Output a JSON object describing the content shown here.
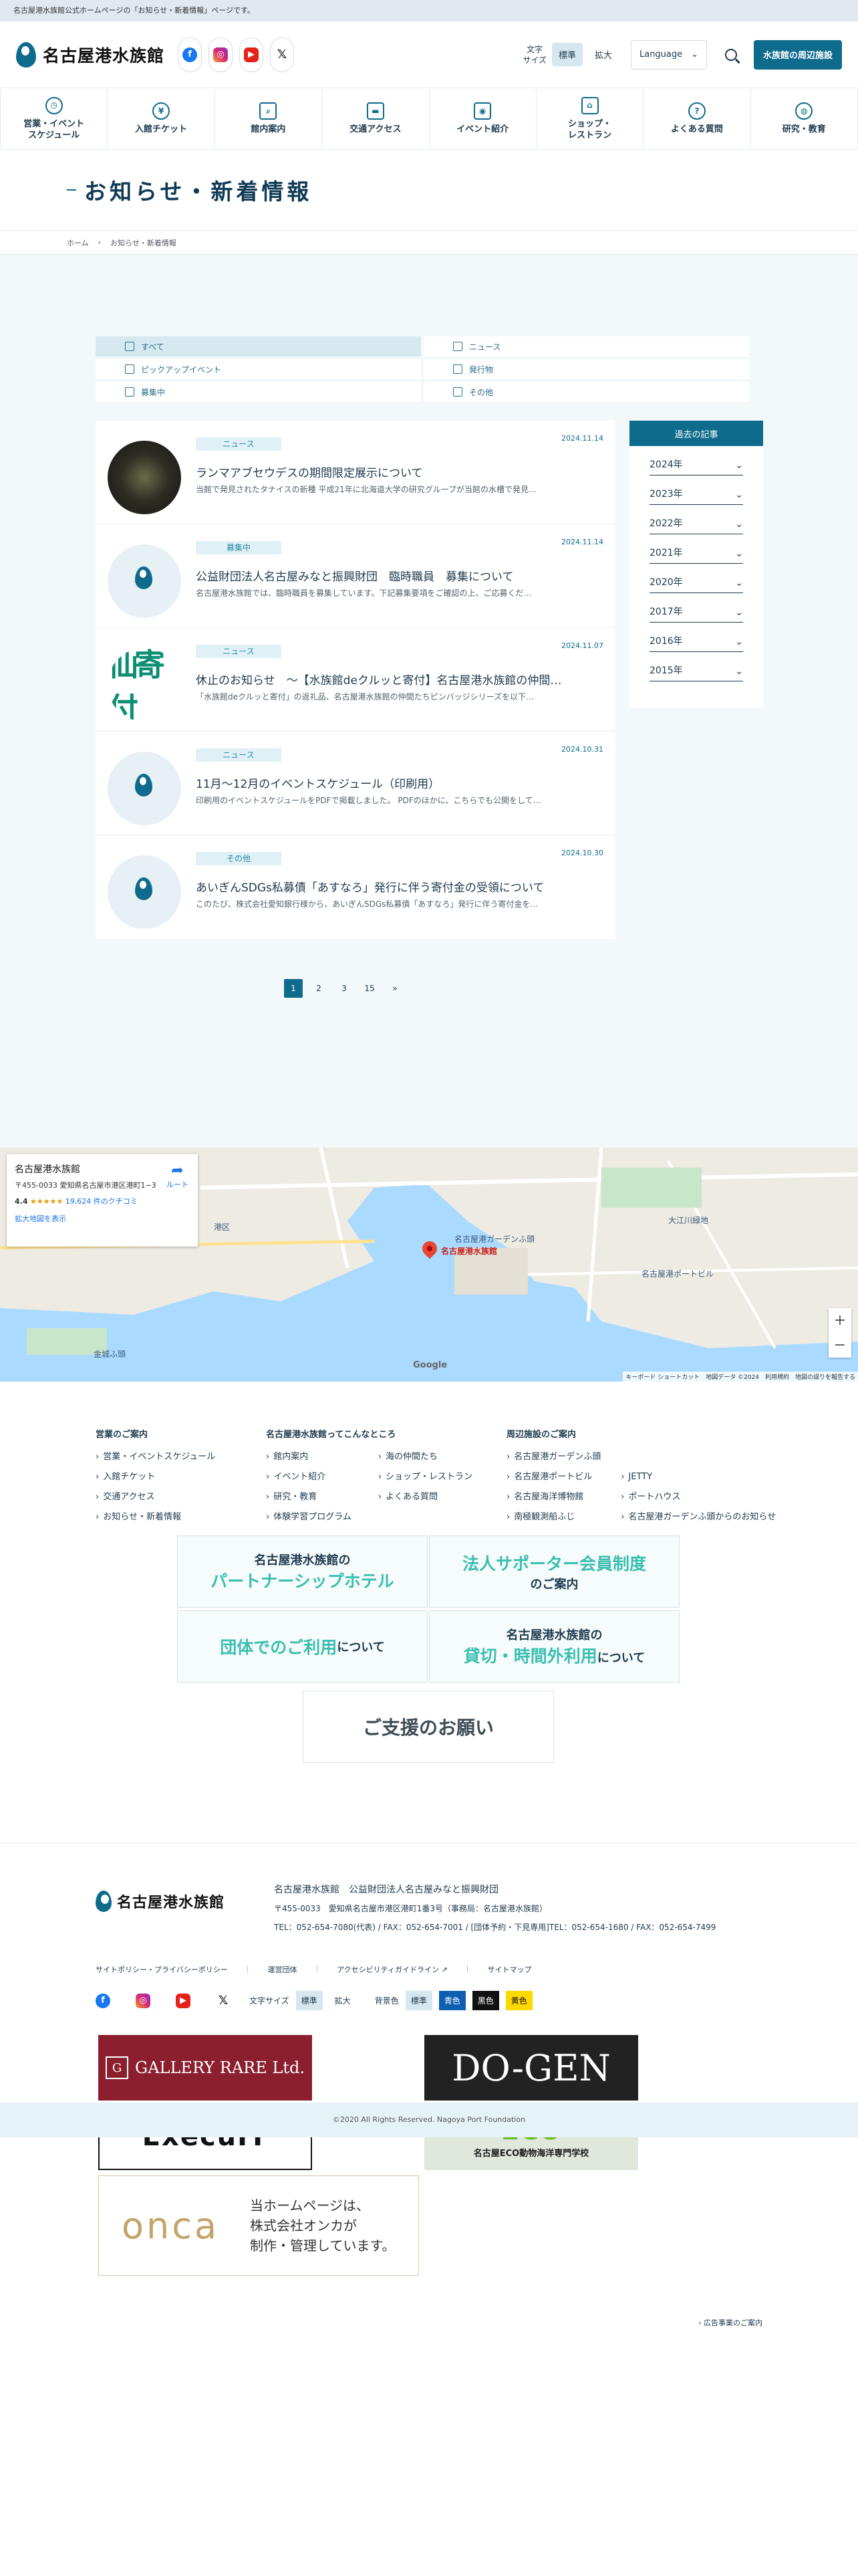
{
  "topnote": "名古屋港水族館公式ホームページの「お知らせ・新着情報」ページです。",
  "header": {
    "logo_text": "名古屋港水族館",
    "fontsize_label": "文字\nサイズ",
    "fontsize_std": "標準",
    "fontsize_large": "拡大",
    "language": "Language",
    "nearby": "水族館の周辺施設"
  },
  "gnav": [
    {
      "label": "営業・イベント\nスケジュール",
      "icon": "clock-icon"
    },
    {
      "label": "入館チケット",
      "icon": "yen-icon"
    },
    {
      "label": "館内案内",
      "icon": "map-search-icon"
    },
    {
      "label": "交通アクセス",
      "icon": "bus-icon"
    },
    {
      "label": "イベント紹介",
      "icon": "camera-icon"
    },
    {
      "label": "ショップ・\nレストラン",
      "icon": "shop-icon"
    },
    {
      "label": "よくある質問",
      "icon": "question-icon"
    },
    {
      "label": "研究・教育",
      "icon": "globe-icon"
    }
  ],
  "page": {
    "title": "お知らせ・新着情報",
    "breadcrumb_home": "ホーム",
    "breadcrumb_current": "お知らせ・新着情報"
  },
  "filters": [
    {
      "label": "すべて",
      "active": true
    },
    {
      "label": "ニュース"
    },
    {
      "label": "ピックアップイベント"
    },
    {
      "label": "発行物"
    },
    {
      "label": "募集中"
    },
    {
      "label": "その他"
    }
  ],
  "news": [
    {
      "tag": "ニュース",
      "date": "2024.11.14",
      "title": "ランマアブセウデスの期間限定展示について",
      "excerpt": "当館で発見されたタナイスの新種 平成21年に北海道大学の研究グループが当館の水槽で発見…",
      "thumb": "dark"
    },
    {
      "tag": "募集中",
      "date": "2024.11.14",
      "title": "公益財団法人名古屋みなと振興財団　臨時職員　募集について",
      "excerpt": "名古屋港水族館では、臨時職員を募集しています。下記募集要項をご確認の上、ご応募くだ…",
      "thumb": "logo"
    },
    {
      "tag": "ニュース",
      "date": "2024.11.07",
      "title": "休止のお知らせ　～【水族館deクルッと寄付】名古屋港水族館の仲間…",
      "excerpt": "「水族館deクルッと寄付」の返礼品、名古屋港水族館の仲間たちピンバッジシリーズを以下…",
      "thumb": "green"
    },
    {
      "tag": "ニュース",
      "date": "2024.10.31",
      "title": "11月～12月のイベントスケジュール（印刷用）",
      "excerpt": "印刷用のイベントスケジュールをPDFで掲載しました。 PDFのほかに、こちらでも公開をして…",
      "thumb": "logo"
    },
    {
      "tag": "その他",
      "date": "2024.10.30",
      "title": "あいぎんSDGs私募債「あすなろ」発行に伴う寄付金の受領について",
      "excerpt": "このたび、株式会社愛知銀行様から、あいぎんSDGs私募債「あすなろ」発行に伴う寄付金を…",
      "thumb": "logo"
    }
  ],
  "news_thumb_green_text": "仙寄付",
  "archive": {
    "heading": "過去の記事",
    "years": [
      "2024年",
      "2023年",
      "2022年",
      "2021年",
      "2020年",
      "2017年",
      "2016年",
      "2015年"
    ]
  },
  "pager": [
    "1",
    "2",
    "3",
    "15",
    "»"
  ],
  "map": {
    "place_name": "名古屋港水族館",
    "address": "〒455-0033 愛知県名古屋市港区港町1−3",
    "rating": "4.4",
    "stars": "★★★★★",
    "reviews": "19,624 件のクチコミ",
    "larger_map": "拡大地図を表示",
    "route": "ルート",
    "pin_label": "名古屋港水族館",
    "google": "Google",
    "footer": "キーボード ショートカット　地図データ ©2024　利用規約　地図の誤りを報告する",
    "labels": [
      "港区",
      "名古屋港ポートビル",
      "大江川緑地",
      "名古屋港ガーデンふ頭",
      "金城ふ頭"
    ]
  },
  "footer": {
    "col1_title": "営業のご案内",
    "col1": [
      "営業・イベントスケジュール",
      "入館チケット",
      "交通アクセス",
      "お知らせ・新着情報"
    ],
    "col2_title": "名古屋港水族館ってこんなところ",
    "col2a": [
      "館内案内",
      "イベント紹介",
      "研究・教育",
      "体験学習プログラム"
    ],
    "col2b": [
      "海の仲間たち",
      "ショップ・レストラン",
      "よくある質問"
    ],
    "col3_title": "周辺施設のご案内",
    "col3a": [
      "名古屋港ガーデンふ頭",
      "名古屋港ポートビル",
      "名古屋海洋博物館",
      "南極観測船ふじ"
    ],
    "col3b": [
      "JETTY",
      "ポートハウス",
      "名古屋港ガーデンふ頭からのお知らせ"
    ]
  },
  "banners": {
    "partner_top": "名古屋港水族館の",
    "partner_big": "パートナーシップホテル",
    "supporter_big": "法人サポーター会員制度",
    "supporter_sub": "のご案内",
    "group_big": "団体でのご利用",
    "group_sub": "について",
    "rental_top": "名古屋港水族館の",
    "rental_big": "貸切・時間外利用",
    "rental_sub": "について",
    "support": "ご支援のお願い"
  },
  "bottom": {
    "logo_text": "名古屋港水族館",
    "org": "名古屋港水族館　公益財団法人名古屋みなと振興財団",
    "address": "〒455-0033　愛知県名古屋市港区港町1番3号（事務局：名古屋港水族館）",
    "tel": "TEL：052-654-7080(代表) / FAX：052-654-7001 / [団体予約・下見専用]TEL：052-654-1680 / FAX：052-654-7499",
    "menu": [
      "サイトポリシー・プライバシーポリシー",
      "運営団体",
      "アクセシビリティガイドライン",
      "サイトマップ"
    ],
    "fontsize_label": "文字サイズ",
    "std": "標準",
    "large": "拡大",
    "bg_label": "背景色",
    "bg_std": "標準",
    "bg_blue": "青色",
    "bg_black": "黒色",
    "bg_yellow": "黄色",
    "sponsor_gallery": "GALLERY RARE Ltd.",
    "sponsor_execuit": "ExecuIT",
    "sponsor_dogen": "DO-GEN",
    "sponsor_eco": "ECO",
    "sponsor_eco_sub": "名古屋ECO動物海洋専門学校",
    "onca_logo": "onca",
    "onca_text": "当ホームページは、\n株式会社オンカが\n制作・管理しています。",
    "ad_guide": "広告事業のご案内",
    "copyright": "©2020 All Rights Reserved. Nagoya Port Foundation"
  },
  "colors": {
    "accent": "#0e6b8c",
    "bg": "#f3f8fb",
    "tag_bg": "#dff0f6"
  }
}
